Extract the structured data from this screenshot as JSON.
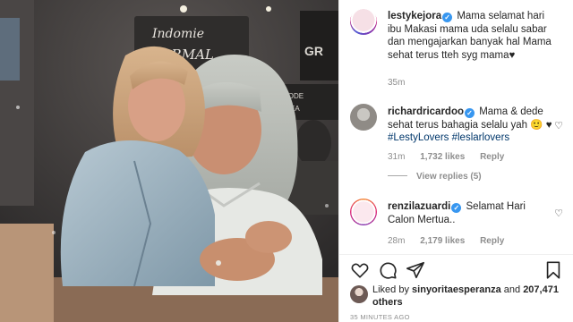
{
  "photo": {
    "sign_text": "Indomie",
    "sign_text_2": "NORMAL",
    "sign_right": "GR",
    "sign_right_2": "CODE",
    "sign_right_3": "IDEA"
  },
  "caption": {
    "username": "lestykejora",
    "text": "Mama selamat hari ibu Makasi mama uda selalu sabar dan mengajarkan banyak hal Mama sehat terus tteh syg mama",
    "heart": "♥",
    "time": "35m"
  },
  "comments": [
    {
      "username": "richardricardoo",
      "text": "Mama & dede sehat terus bahagia selalu yah",
      "emoji": "🙂",
      "heart": "♥",
      "tags": [
        "#LestyLovers",
        "#leslarlovers"
      ],
      "time": "31m",
      "likes": "1,732 likes",
      "reply": "Reply",
      "view_replies": "View replies (5)"
    },
    {
      "username": "renzilazuardi",
      "text": "Selamat Hari Calon Mertua..",
      "time": "28m",
      "likes": "2,179 likes",
      "reply": "Reply"
    }
  ],
  "likes": {
    "prefix": "Liked by",
    "user": "sinyoritaesperanza",
    "and": "and",
    "count": "207,471 others"
  },
  "timestamp": "35 MINUTES AGO",
  "colors": {
    "link": "#00376b",
    "verified": "#3897f0",
    "muted": "#8e8e8e"
  },
  "icons": [
    "heart-icon",
    "comment-icon",
    "share-icon",
    "bookmark-icon",
    "verified-icon",
    "small-heart-icon"
  ]
}
